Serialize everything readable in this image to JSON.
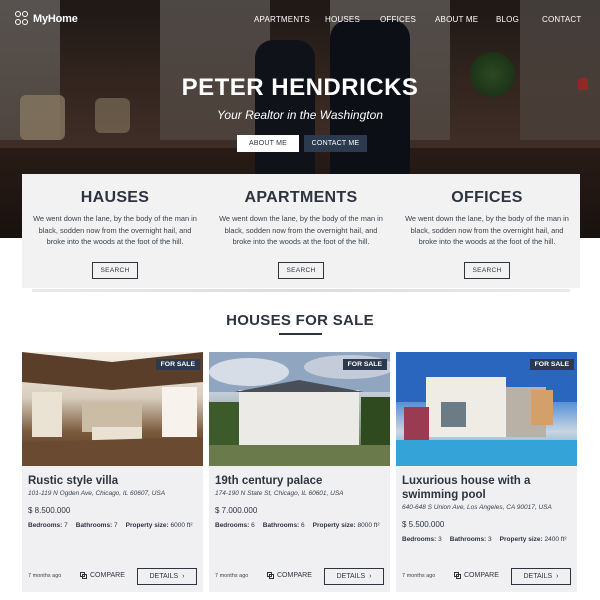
{
  "brand": {
    "name": "MyHome"
  },
  "nav": {
    "items": [
      "APARTMENTS",
      "HOUSES",
      "OFFICES",
      "ABOUT ME",
      "BLOG",
      "CONTACT"
    ]
  },
  "hero": {
    "title": "PETER HENDRICKS",
    "subtitle": "Your Realtor in the Washington",
    "about_btn": "ABOUT ME",
    "contact_btn": "CONTACT ME"
  },
  "categories": [
    {
      "title": "HAUSES",
      "text": "We went down the lane, by the body of the man in black, sodden now from the overnight hail, and broke into the woods at the foot of the hill.",
      "button": "SEARCH"
    },
    {
      "title": "APARTMENTS",
      "text": "We went down the lane, by the body of the man in black, sodden now from the overnight hail, and broke into the woods at the foot of the hill.",
      "button": "SEARCH"
    },
    {
      "title": "OFFICES",
      "text": "We went down the lane, by the body of the man in black, sodden now from the overnight hail, and broke into the woods at the foot of the hill.",
      "button": "SEARCH"
    }
  ],
  "section": {
    "title": "HOUSES FOR SALE"
  },
  "listings": [
    {
      "badge": "FOR SALE",
      "name": "Rustic style villa",
      "address": "101-119 N Ogden Ave, Chicago, IL 60607, USA",
      "price": "$ 8.500.000",
      "bedrooms_label": "Bedrooms:",
      "bedrooms": "7",
      "bathrooms_label": "Bathrooms:",
      "bathrooms": "7",
      "size_label": "Property size:",
      "size": "6000 ft²",
      "age": "7 months ago",
      "compare": "COMPARE",
      "details": "DETAILS",
      "details_icon": "›"
    },
    {
      "badge": "FOR SALE",
      "name": "19th century palace",
      "address": "174-190 N State St, Chicago, IL 60601, USA",
      "price": "$ 7.000.000",
      "bedrooms_label": "Bedrooms:",
      "bedrooms": "6",
      "bathrooms_label": "Bathrooms:",
      "bathrooms": "6",
      "size_label": "Property size:",
      "size": "8000 ft²",
      "age": "7 months ago",
      "compare": "COMPARE",
      "details": "DETAILS",
      "details_icon": "›"
    },
    {
      "badge": "FOR SALE",
      "name": "Luxurious house with a swimming pool",
      "address": "640-648 S Union Ave, Los Angeles, CA 90017, USA",
      "price": "$ 5.500.000",
      "bedrooms_label": "Bedrooms:",
      "bedrooms": "3",
      "bathrooms_label": "Bathrooms:",
      "bathrooms": "3",
      "size_label": "Property size:",
      "size": "2400 ft²",
      "age": "7 months ago",
      "compare": "COMPARE",
      "details": "DETAILS",
      "details_icon": "›"
    }
  ],
  "colors": {
    "primary": "#2b3a4f",
    "text": "#2d3440",
    "panel": "#f2f2f3"
  }
}
